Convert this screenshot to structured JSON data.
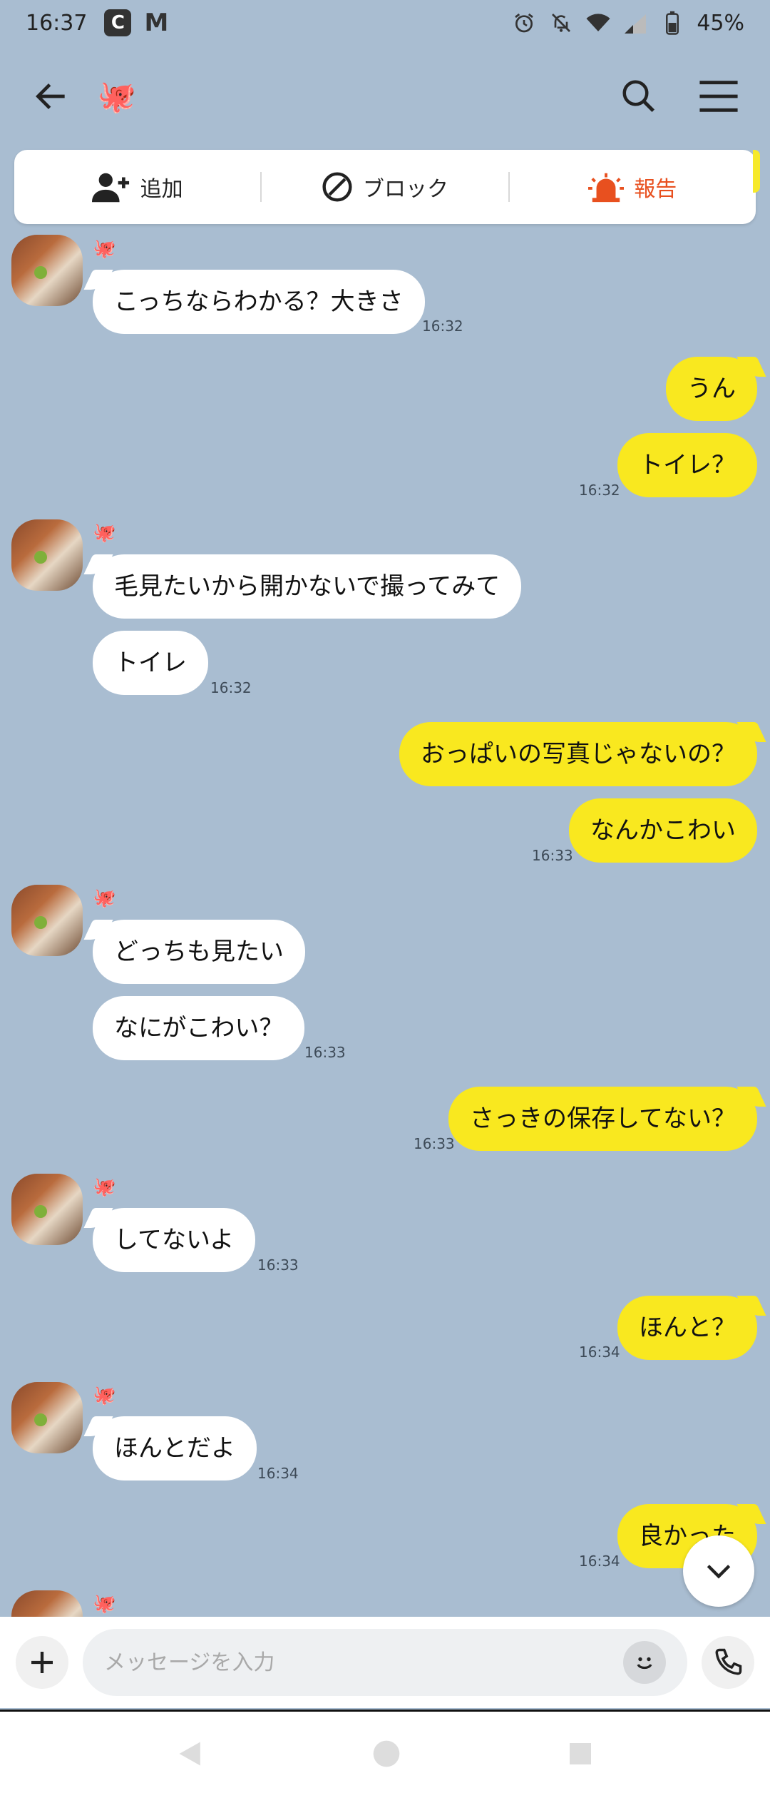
{
  "status_bar": {
    "time": "16:37",
    "app_letter": "C",
    "gmail_letter": "M",
    "battery": "45%"
  },
  "header": {
    "title_emoji": "🐙"
  },
  "actions": {
    "add": "追加",
    "block": "ブロック",
    "report": "報告"
  },
  "colors": {
    "background": "#a9bdd1",
    "outgoing_bubble": "#f9e81f",
    "incoming_bubble": "#ffffff",
    "report": "#e8501f"
  },
  "messages": {
    "g1": {
      "name": "🐙",
      "text": "こっちならわかる？大きさ",
      "time": "16:32"
    },
    "o1": {
      "text1": "うん",
      "text2": "トイレ？",
      "time": "16:32"
    },
    "g2": {
      "name": "🐙",
      "text1": "毛見たいから開かないで撮ってみて",
      "text2": "トイレ",
      "time": "16:32"
    },
    "o2": {
      "text1": "おっぱいの写真じゃないの？",
      "text2": "なんかこわい",
      "time": "16:33"
    },
    "g3": {
      "name": "🐙",
      "text1": "どっちも見たい",
      "text2": "なにがこわい？",
      "time": "16:33"
    },
    "o3": {
      "text": "さっきの保存してない？",
      "time": "16:33"
    },
    "g4": {
      "name": "🐙",
      "text": "してないよ",
      "time": "16:33"
    },
    "o4": {
      "text": "ほんと？",
      "time": "16:34"
    },
    "g5": {
      "name": "🐙",
      "text": "ほんとだよ",
      "time": "16:34"
    },
    "o5": {
      "text": "良かった",
      "time": "16:34"
    },
    "g6": {
      "name": "🐙"
    }
  },
  "input": {
    "placeholder": "メッセージを入力"
  }
}
